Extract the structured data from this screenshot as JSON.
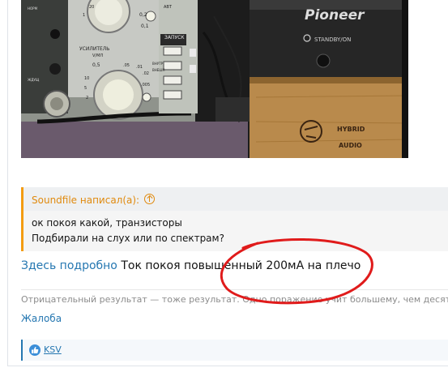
{
  "photo": {
    "alt": "",
    "panel_labels": [
      "УСИЛИТЕЛЬ",
      "V/МЛ",
      "ЗАПУСК",
      "ВНУТР",
      "ВНЕШН",
      "АВТ",
      "НОРМ",
      "ЖДУЩ",
      "0,5",
      "0,2",
      "0,1",
      ".02",
      ".005",
      ".05",
      ".01",
      "20",
      "10",
      "5",
      "2",
      "1"
    ],
    "brand": "Pioneer",
    "standby_label": "STANDBY/ON",
    "logo_line1": "HYBRID",
    "logo_line2": "AUDIO"
  },
  "quote": {
    "author": "Soundfile написал(а):",
    "lines": [
      "ок покоя какой, транзисторы",
      "Подбирали на слух или по спектрам?"
    ]
  },
  "message": {
    "link_text": "Здесь подробно",
    "text": "Ток покоя повышенный 200мА на плечо"
  },
  "signature": "Отрицательный результат — тоже результат. Одно поражение учит большему, чем десять побед",
  "actions": {
    "report": "Жалоба"
  },
  "reactions": {
    "user": "KSV"
  },
  "colors": {
    "accent": "#2577b1",
    "quote_border": "#f39c12",
    "annotation": "#e01b1b"
  }
}
